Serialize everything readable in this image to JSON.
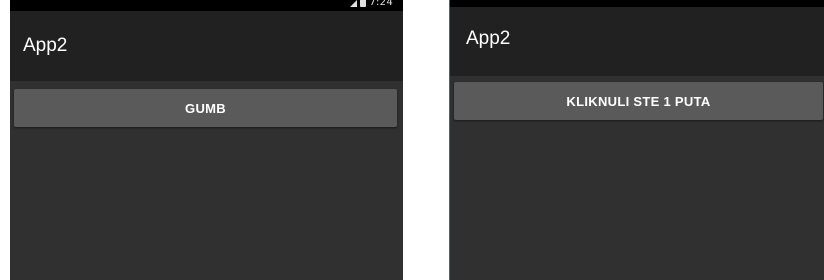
{
  "screens": [
    {
      "status_bar": {
        "time": "7:24"
      },
      "app_bar": {
        "title": "App2"
      },
      "button": {
        "label": "GUMB"
      }
    },
    {
      "app_bar": {
        "title": "App2"
      },
      "button": {
        "label": "KLIKNULI STE 1 PUTA"
      }
    }
  ],
  "colors": {
    "status_bar": "#000000",
    "app_bar": "#212121",
    "content_background": "#303030",
    "button_background": "#5a5a5a",
    "text": "#ffffff"
  },
  "icons": [
    "signal-icon",
    "battery-icon"
  ]
}
